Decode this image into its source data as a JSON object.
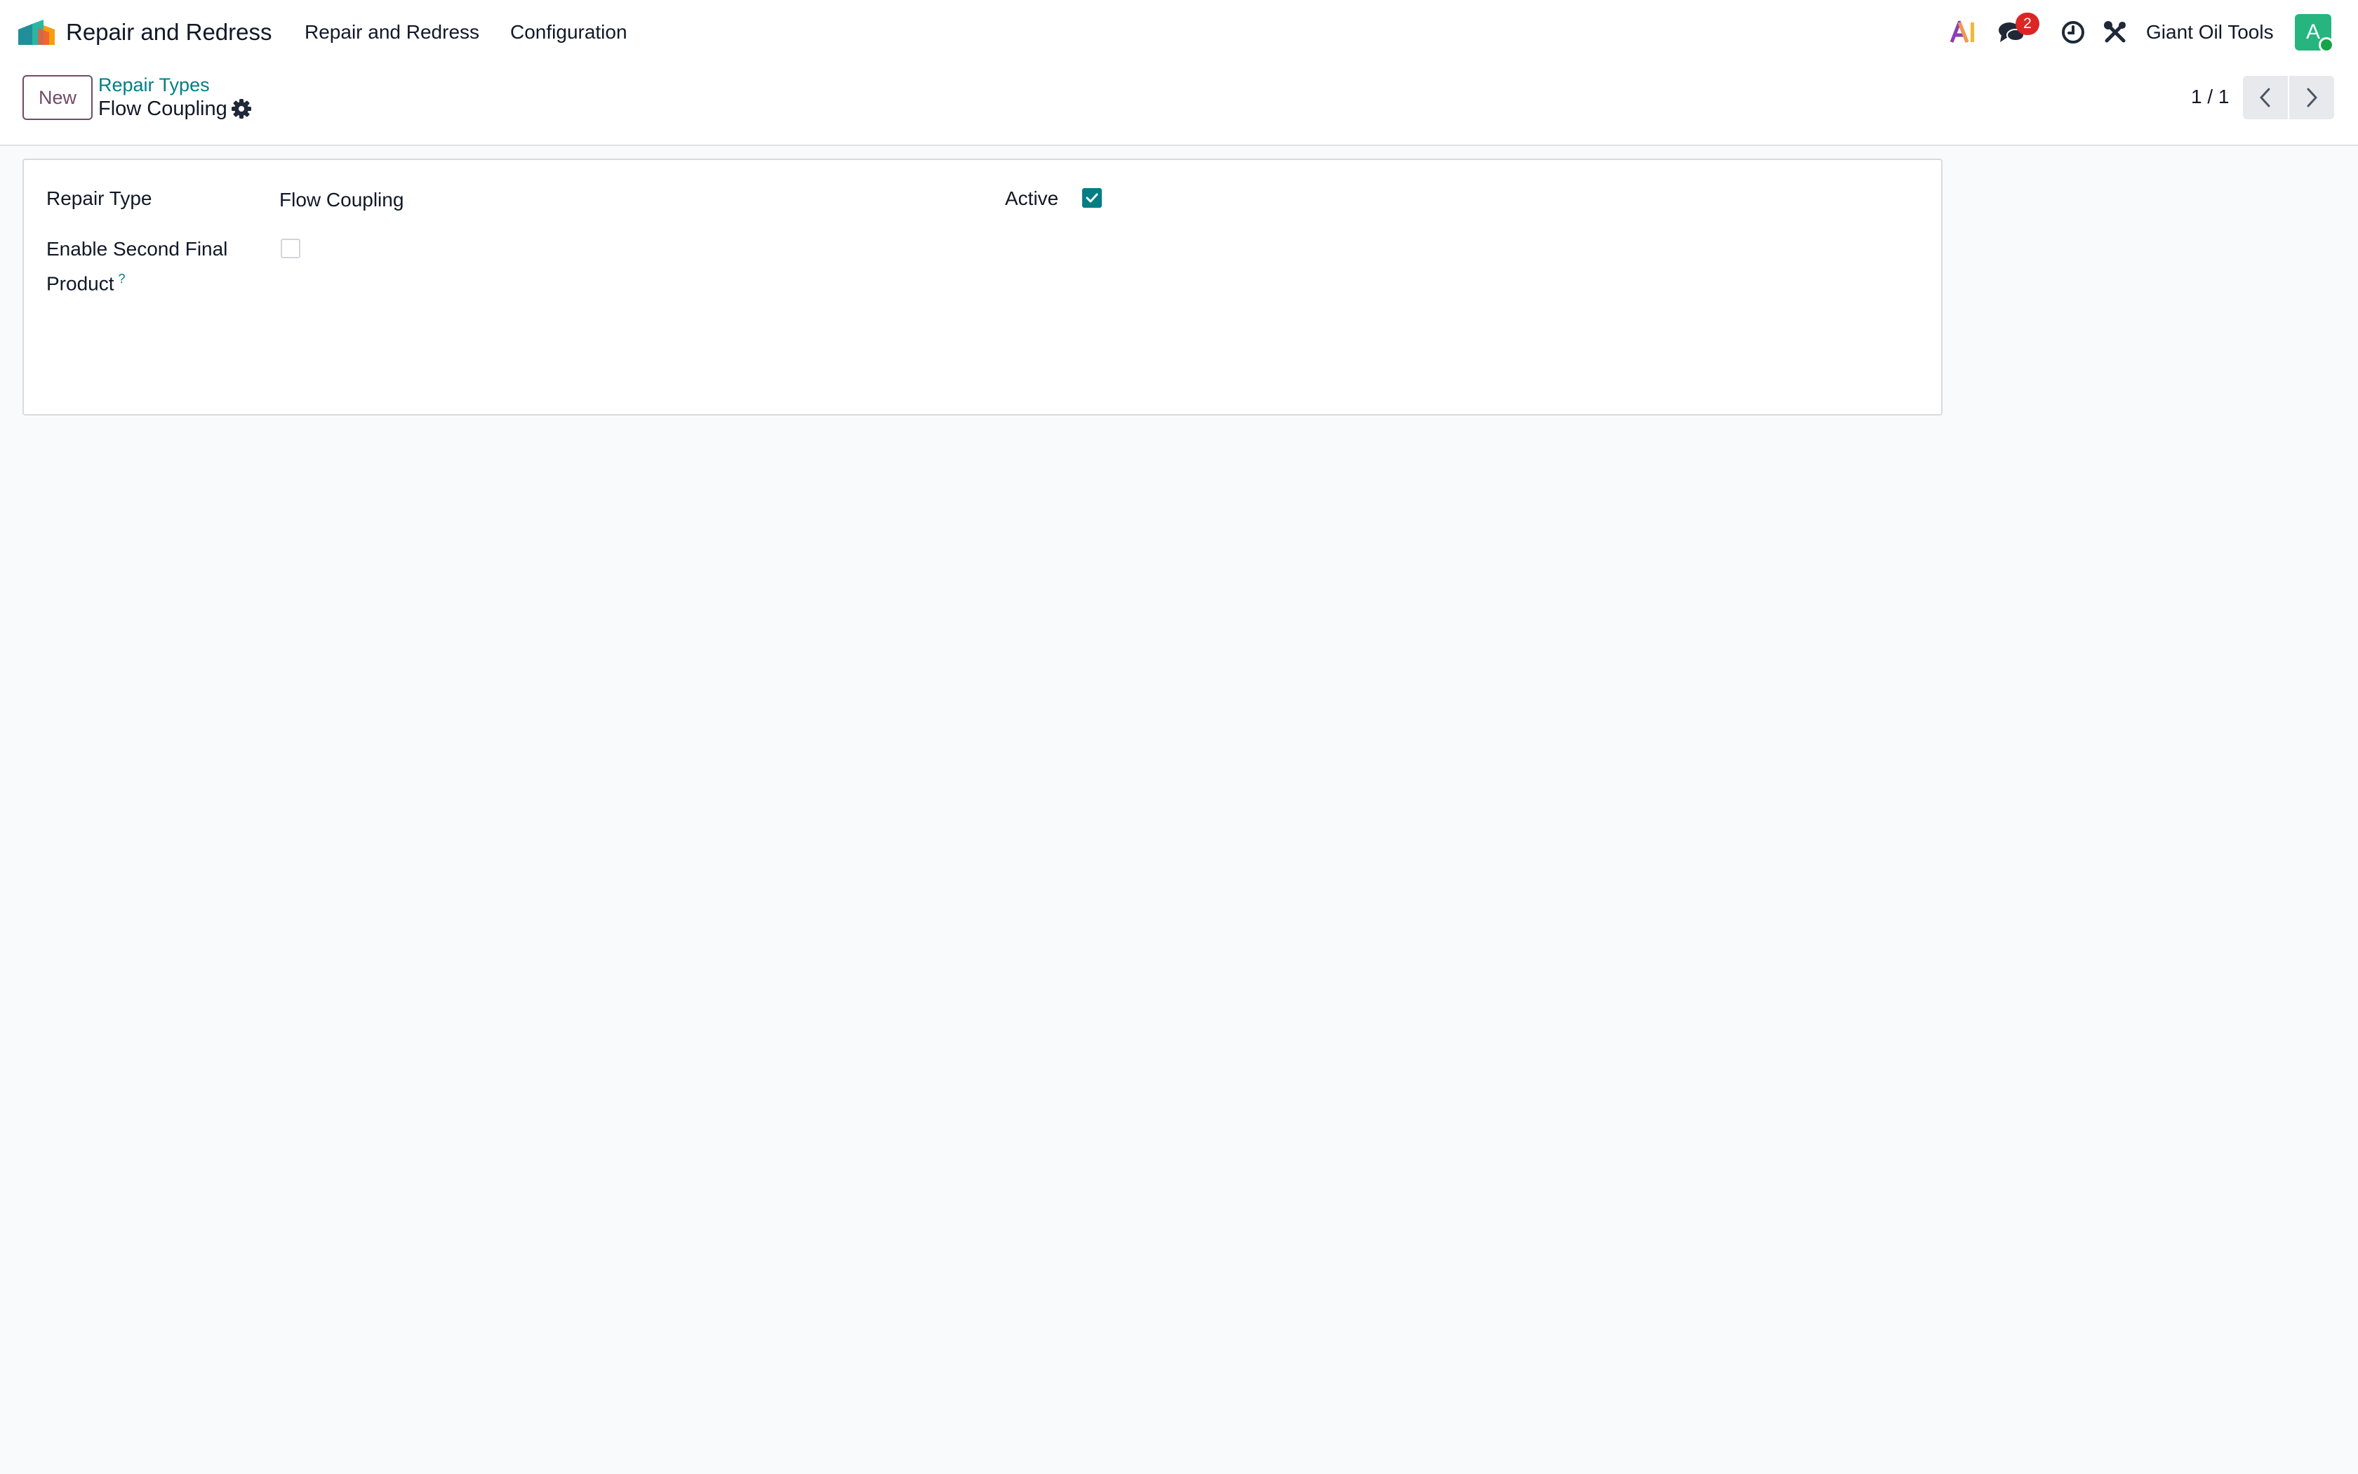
{
  "navbar": {
    "app_name": "Repair and Redress",
    "menu": [
      {
        "label": "Repair and Redress"
      },
      {
        "label": "Configuration"
      }
    ],
    "messages_badge": "2",
    "company": "Giant Oil Tools",
    "avatar_initial": "A",
    "icons": [
      "app-logo-icon",
      "ai-icon",
      "chat-icon",
      "clock-icon",
      "tools-icon"
    ]
  },
  "control_panel": {
    "new_label": "New",
    "breadcrumb_parent": "Repair Types",
    "record_title": "Flow Coupling",
    "pager": "1 / 1"
  },
  "form": {
    "repair_type_label": "Repair Type",
    "repair_type_value": "Flow Coupling",
    "active_label": "Active",
    "active_checked": true,
    "second_product_label": "Enable Second Final Product",
    "second_product_help": "?",
    "second_product_checked": false
  },
  "colors": {
    "accent_teal": "#017e84",
    "brand_purple": "#714b67",
    "badge_red": "#dc2626",
    "avatar_green": "#26b57f"
  }
}
